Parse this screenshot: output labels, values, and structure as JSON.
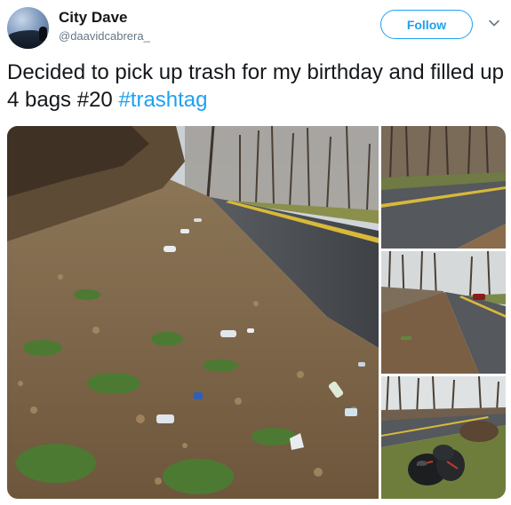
{
  "author": {
    "display_name": "City Dave",
    "handle": "@daavidcabrera_"
  },
  "actions": {
    "follow_label": "Follow",
    "more_icon": "chevron-down-icon"
  },
  "tweet": {
    "text_before": "Decided to pick up trash for my birthday and filled up 4 bags #20 ",
    "hashtag": "#trashtag"
  },
  "media": {
    "photos": [
      "roadside-trash-main",
      "road-curve",
      "road-with-car",
      "filled-trash-bags"
    ]
  },
  "colors": {
    "accent": "#1da1f2",
    "secondary_text": "#657786",
    "primary_text": "#14171a"
  }
}
